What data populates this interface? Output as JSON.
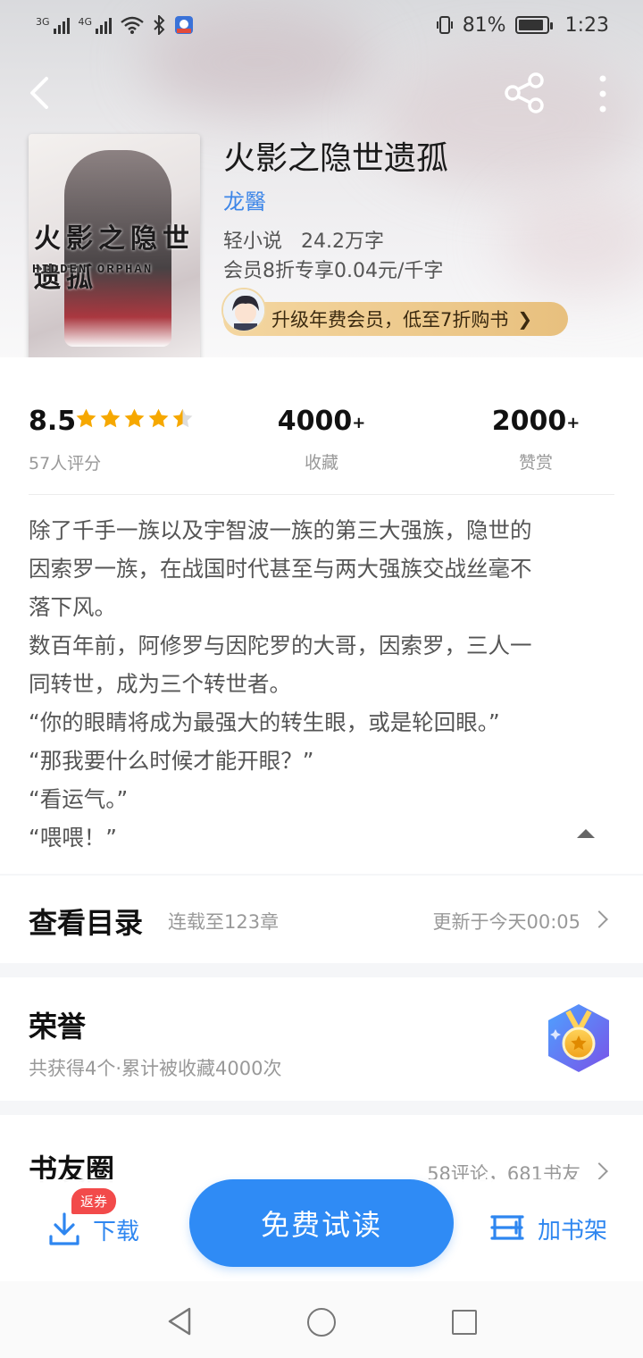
{
  "status_bar": {
    "net1": "3G",
    "net2": "4G",
    "battery": "81%",
    "time": "1:23"
  },
  "book": {
    "title": "火影之隐世遗孤",
    "author": "龙醫",
    "category_words": "轻小说   24.2万字",
    "vip_price": "会员8折专享0.04元/千字",
    "vip_banner": "升级年费会员，低至7折购书",
    "cover_title": "火影之隐世遗孤",
    "cover_subtitle": "HIDDEN ORPHAN"
  },
  "stats": {
    "rating": "8.5",
    "rating_stars": 4.5,
    "rating_count": "57人评分",
    "collect_num": "4000",
    "collect_plus": "+",
    "collect_label": "收藏",
    "like_num": "2000",
    "like_plus": "+",
    "like_label": "赞赏"
  },
  "description": [
    "除了千手一族以及宇智波一族的第三大强族，隐世的",
    "因索罗一族，在战国时代甚至与两大强族交战丝毫不",
    "落下风。",
    "数百年前，阿修罗与因陀罗的大哥，因索罗，三人一",
    "同转世，成为三个转世者。",
    "“你的眼睛将成为最强大的转生眼，或是轮回眼。”",
    "“那我要什么时候才能开眼？”",
    "“看运气。”",
    "“喂喂！”"
  ],
  "toc": {
    "title": "查看目录",
    "status": "连载至123章",
    "updated": "更新于今天00:05"
  },
  "honor": {
    "title": "荣誉",
    "summary": "共获得4个·累计被收藏4000次"
  },
  "circle": {
    "title": "书友圈",
    "summary": "58评论，681书友"
  },
  "actions": {
    "badge": "返券",
    "download": "下载",
    "read": "免费试读",
    "shelf": "加书架"
  },
  "colors": {
    "accent": "#2f8bf5",
    "author": "#3d86e8",
    "star": "#f6a800",
    "vip_gold": "#e8c07e",
    "badge_red": "#f24a4a"
  }
}
